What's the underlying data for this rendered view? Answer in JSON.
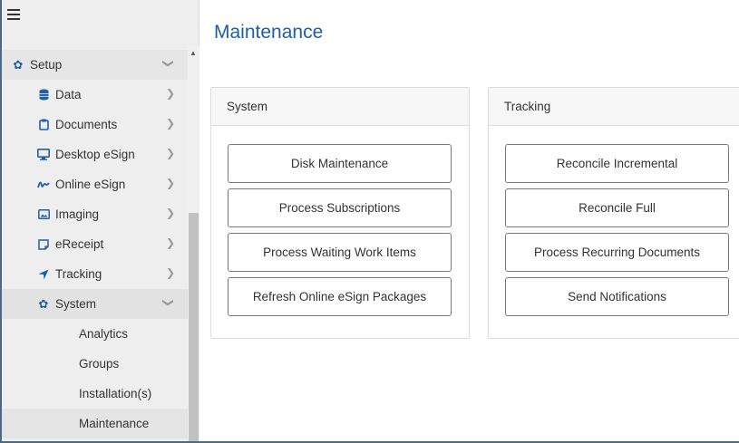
{
  "sidebar": {
    "menu": {
      "setup": {
        "label": "Setup",
        "icon": "gear-icon"
      },
      "items": [
        {
          "label": "Data",
          "icon": "database-icon"
        },
        {
          "label": "Documents",
          "icon": "clipboard-icon"
        },
        {
          "label": "Desktop eSign",
          "icon": "monitor-icon"
        },
        {
          "label": "Online eSign",
          "icon": "signature-icon"
        },
        {
          "label": "Imaging",
          "icon": "image-icon"
        },
        {
          "label": "eReceipt",
          "icon": "receipt-icon"
        },
        {
          "label": "Tracking",
          "icon": "location-arrow-icon"
        },
        {
          "label": "System",
          "icon": "cogs-icon"
        }
      ],
      "system_children": [
        {
          "label": "Analytics"
        },
        {
          "label": "Groups"
        },
        {
          "label": "Installation(s)"
        },
        {
          "label": "Maintenance"
        }
      ]
    }
  },
  "main": {
    "title": "Maintenance",
    "panels": [
      {
        "title": "System",
        "buttons": [
          {
            "label": "Disk Maintenance"
          },
          {
            "label": "Process Subscriptions"
          },
          {
            "label": "Process Waiting Work Items"
          },
          {
            "label": "Refresh Online eSign Packages"
          }
        ]
      },
      {
        "title": "Tracking",
        "buttons": [
          {
            "label": "Reconcile Incremental"
          },
          {
            "label": "Reconcile Full"
          },
          {
            "label": "Process Recurring Documents"
          },
          {
            "label": "Send Notifications"
          }
        ]
      }
    ]
  },
  "colors": {
    "accent": "#1f5fa8",
    "sidebar_bg": "#eeeeee"
  }
}
